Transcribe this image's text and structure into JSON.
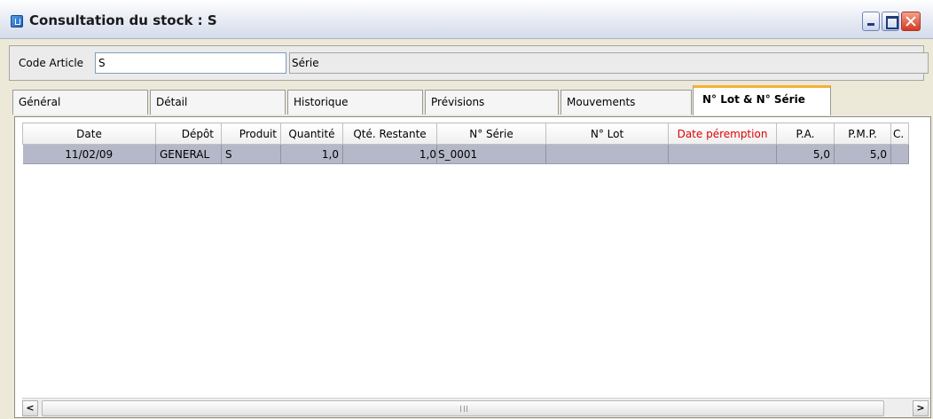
{
  "window": {
    "title": "Consultation du stock : S"
  },
  "filters": {
    "code_article_label": "Code Article",
    "code_article_value": "S",
    "serie_label": "Série"
  },
  "tabs": [
    {
      "label": "Général",
      "active": false
    },
    {
      "label": "Détail",
      "active": false
    },
    {
      "label": "Historique",
      "active": false
    },
    {
      "label": "Prévisions",
      "active": false
    },
    {
      "label": "Mouvements",
      "active": false
    },
    {
      "label": "N° Lot & N° Série",
      "active": true
    }
  ],
  "grid": {
    "columns": [
      "Date",
      "Dépôt",
      "Produit",
      "Quantité",
      "Qté. Restante",
      "N° Série",
      "N° Lot",
      "Date péremption",
      "P.A.",
      "P.M.P.",
      "C."
    ],
    "rows": [
      [
        "11/02/09",
        "GENERAL",
        "S",
        "1,0",
        "1,0",
        "S_0001",
        "",
        "",
        "5,0",
        "5,0",
        ""
      ]
    ]
  },
  "colors": {
    "header_highlight": "#e00000",
    "selected_row": "#b5b8c8",
    "active_tab_accent": "#f3b233"
  },
  "icons": {
    "title_icon": "app-icon",
    "scroll_left": "chevron-left-icon",
    "scroll_right": "chevron-right-icon"
  }
}
